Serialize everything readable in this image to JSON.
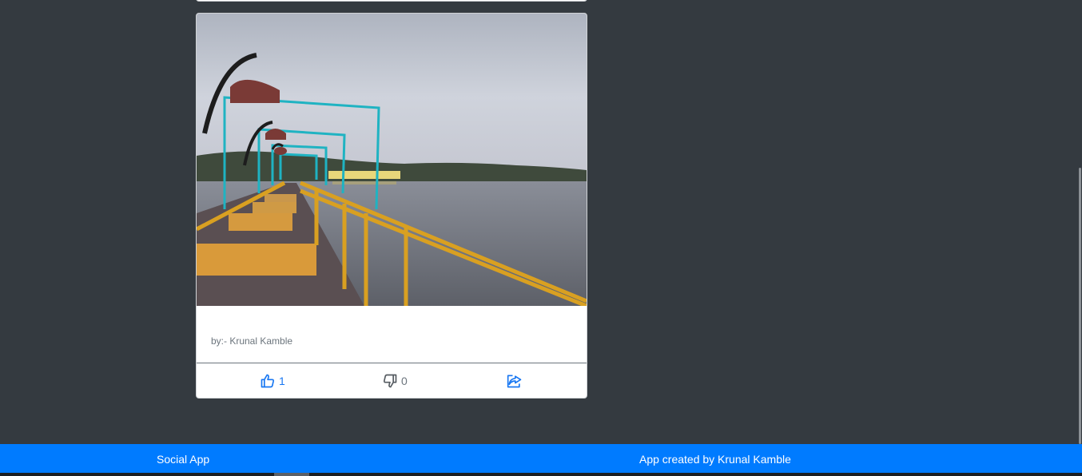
{
  "post": {
    "author": "by:- Krunal Kamble",
    "likes": "1",
    "dislikes": "0"
  },
  "icons": {
    "like": "thumbs-up-icon",
    "dislike": "thumbs-down-icon",
    "share": "share-icon"
  },
  "footer": {
    "brand": "Social App",
    "credit": "App created by Krunal Kamble"
  },
  "colors": {
    "background": "#343a40",
    "accent": "#007bff",
    "like": "#1877f2",
    "muted": "#6c757d"
  }
}
